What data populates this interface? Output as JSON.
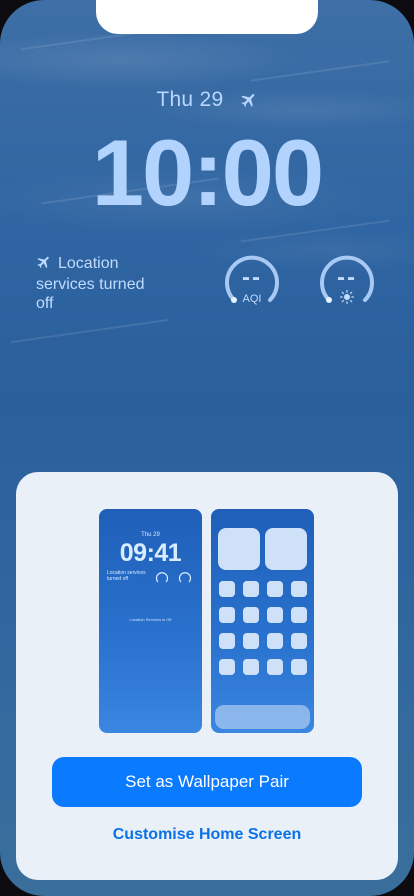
{
  "lock_screen": {
    "date": "Thu 29",
    "time": "10:00",
    "location_text": "Location services turned off",
    "widgets": [
      {
        "value": "--",
        "caption": "AQI",
        "icon": "aqi"
      },
      {
        "value": "--",
        "caption": "",
        "icon": "sun-icon"
      }
    ]
  },
  "preview": {
    "lock": {
      "date": "Thu 29",
      "time": "09:41",
      "location_text": "Location services turned off",
      "footer": "Location Services is Off"
    }
  },
  "actions": {
    "primary": "Set as Wallpaper Pair",
    "secondary": "Customise Home Screen"
  },
  "colors": {
    "accent": "#0a7aff",
    "sheet": "#e9f0f8",
    "wallpaper": "#2f65a2"
  }
}
